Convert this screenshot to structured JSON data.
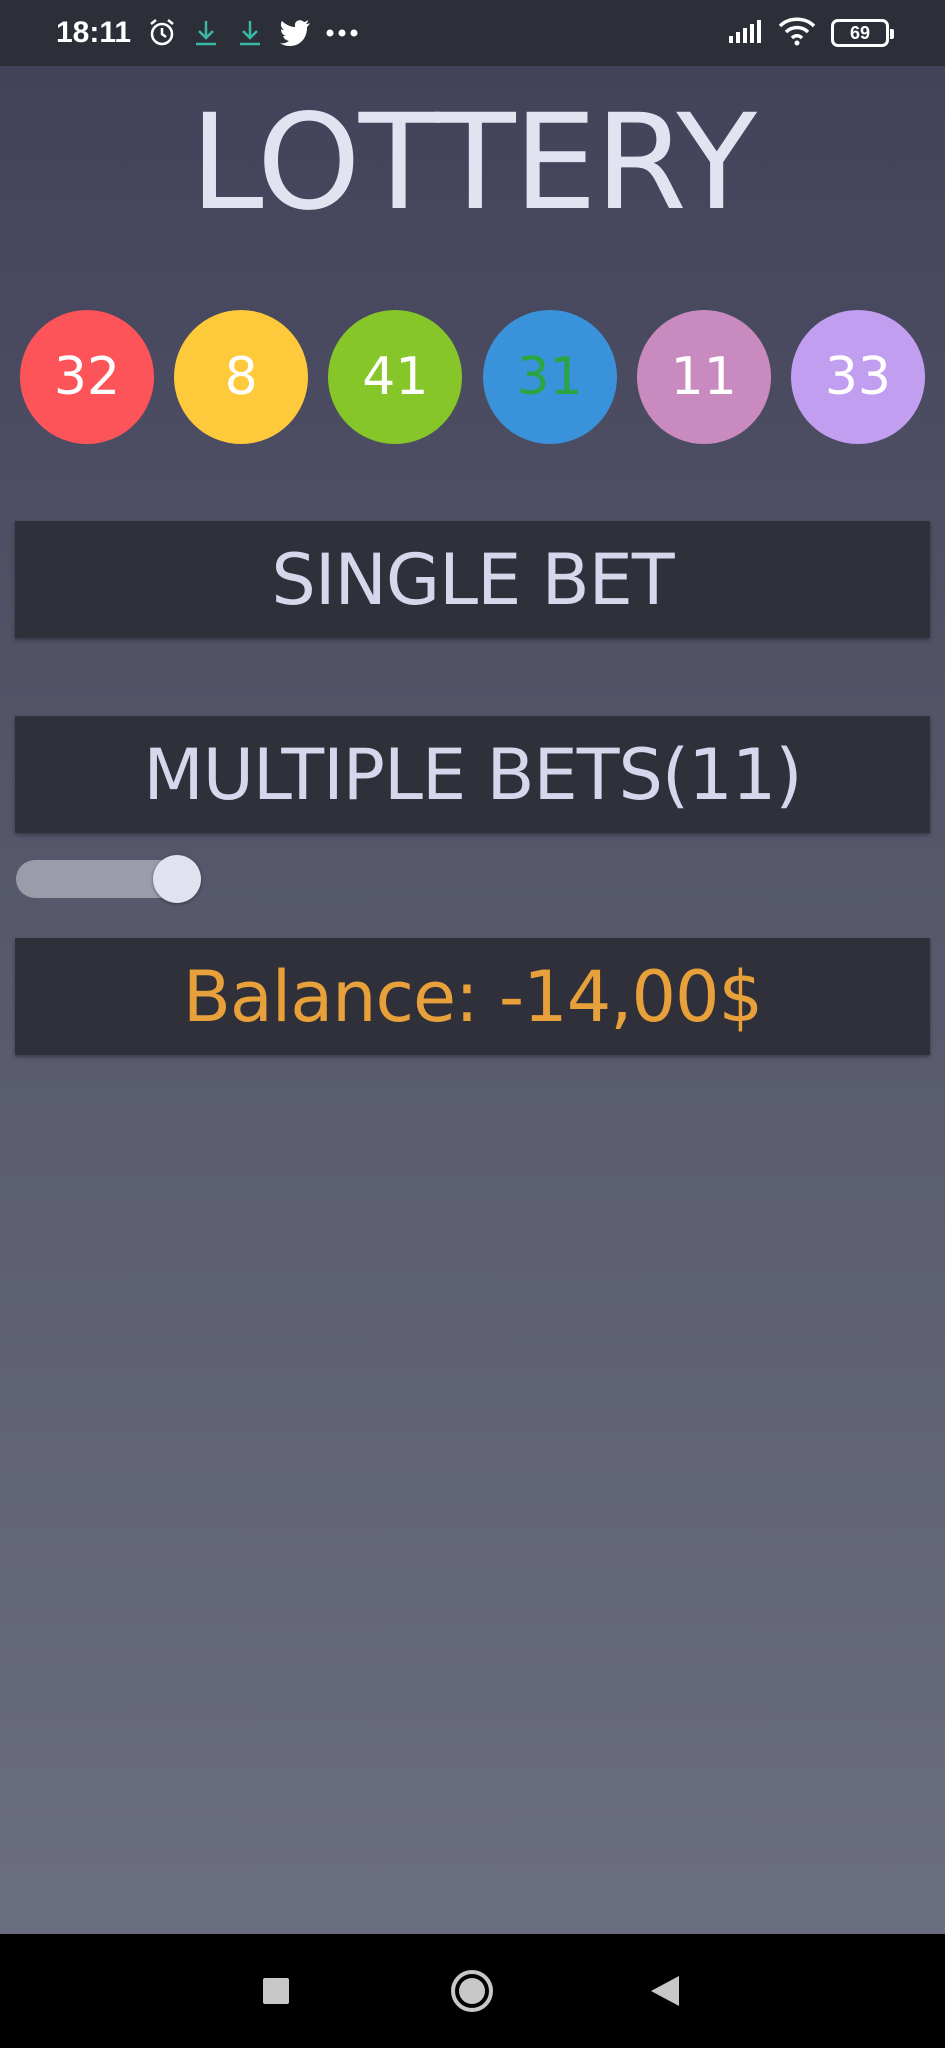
{
  "status_bar": {
    "time": "18:11",
    "battery_level": "69",
    "icons_left": [
      "alarm-icon",
      "download-icon",
      "download-icon",
      "twitter-icon",
      "more-icon"
    ],
    "icons_right": [
      "signal-icon",
      "wifi-icon",
      "battery-icon"
    ]
  },
  "app": {
    "title": "LOTTERY",
    "balls": [
      {
        "number": "32",
        "color": "#fd5459",
        "text_color": "#ffffff"
      },
      {
        "number": "8",
        "color": "#fec93a",
        "text_color": "#ffffff"
      },
      {
        "number": "41",
        "color": "#86c628",
        "text_color": "#ffffff"
      },
      {
        "number": "31",
        "color": "#3a92da",
        "text_color": "#2aa544"
      },
      {
        "number": "11",
        "color": "#c98bbf",
        "text_color": "#ffffff"
      },
      {
        "number": "33",
        "color": "#c29ef1",
        "text_color": "#ffffff"
      }
    ],
    "single_bet_label": "SINGLE BET",
    "multiple_bets_label": "MULTIPLE BETS(11)",
    "toggle_on": true,
    "balance_label": "Balance: -14,00$",
    "balance_color": "#e7a03a"
  },
  "nav_bar": {
    "icons": [
      "recents-icon",
      "home-icon",
      "back-icon"
    ]
  }
}
